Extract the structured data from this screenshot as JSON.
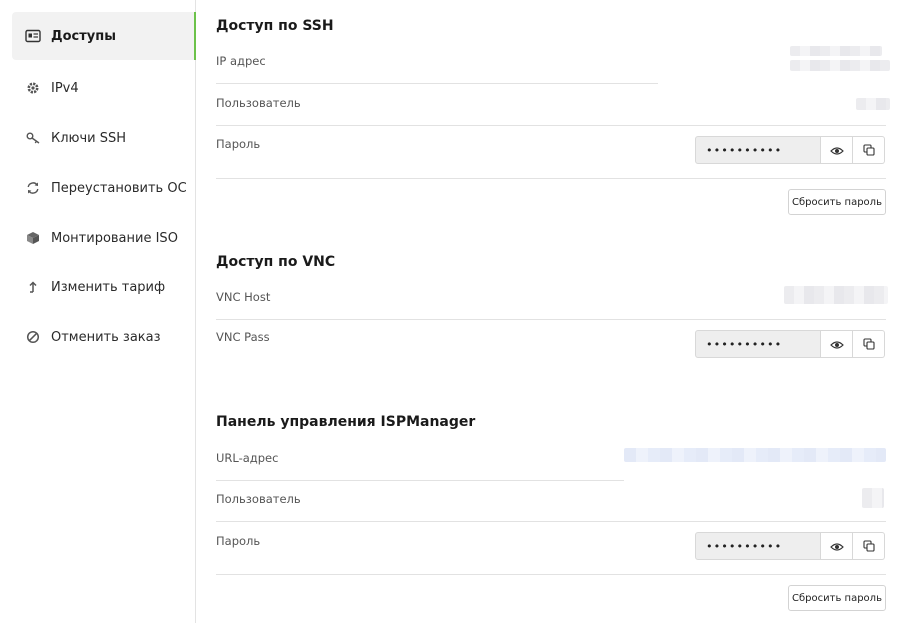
{
  "sidebar": {
    "items": [
      {
        "label": "Доступы",
        "icon": "id-card-icon",
        "active": true
      },
      {
        "label": "IPv4",
        "icon": "gear-icon",
        "active": false
      },
      {
        "label": "Ключи SSH",
        "icon": "key-icon",
        "active": false
      },
      {
        "label": "Переустановить ОС",
        "icon": "refresh-icon",
        "active": false
      },
      {
        "label": "Монтирование ISO",
        "icon": "cube-icon",
        "active": false
      },
      {
        "label": "Изменить тариф",
        "icon": "arrow-up-icon",
        "active": false
      },
      {
        "label": "Отменить заказ",
        "icon": "cancel-icon",
        "active": false
      }
    ]
  },
  "ssh": {
    "title": "Доступ по SSH",
    "ip_label": "IP адрес",
    "user_label": "Пользователь",
    "password_label": "Пароль",
    "password_value": "••••••••••",
    "reset_label": "Сбросить пароль"
  },
  "vnc": {
    "title": "Доступ по VNC",
    "host_label": "VNC Host",
    "pass_label": "VNC Pass",
    "pass_value": "••••••••••"
  },
  "isp": {
    "title": "Панель управления ISPManager",
    "url_label": "URL-адрес",
    "user_label": "Пользователь",
    "password_label": "Пароль",
    "password_value": "••••••••••",
    "reset_label": "Сбросить пароль"
  },
  "colors": {
    "accent": "#6cc24a",
    "active_bg": "#f2f2f2"
  }
}
